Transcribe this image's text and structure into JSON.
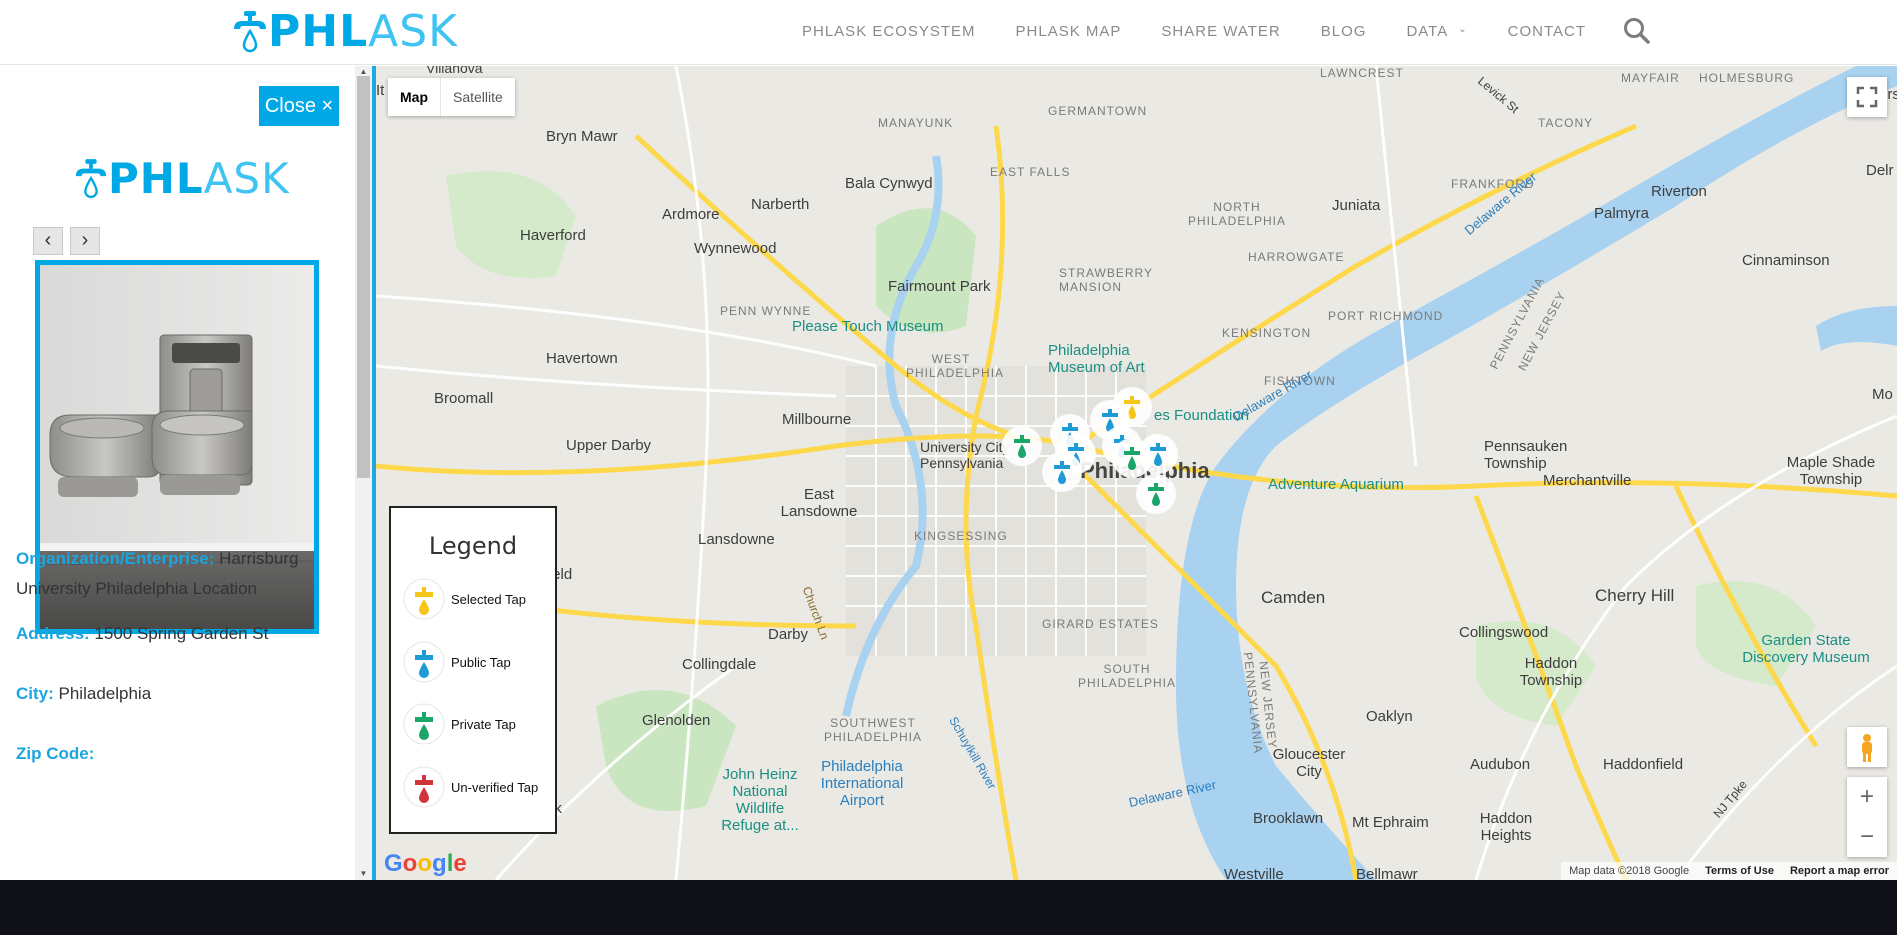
{
  "brand": {
    "logo_part1": "PHL",
    "logo_part2": "ASK",
    "accent": "#00a8e6",
    "accent_light": "#3fc3f3"
  },
  "nav": {
    "items": [
      {
        "label": "PHLASK ECOSYSTEM"
      },
      {
        "label": "PHLASK MAP"
      },
      {
        "label": "SHARE WATER"
      },
      {
        "label": "BLOG"
      },
      {
        "label": "DATA",
        "has_dropdown": true
      },
      {
        "label": "CONTACT"
      }
    ],
    "search_icon": "search-icon"
  },
  "sidepanel": {
    "close_label": "Close ×",
    "prev_label": "‹",
    "next_label": "›",
    "photo_alt_icon": "water-fountain-photo",
    "fields": [
      {
        "key": "Organization/Enterprise:",
        "value": "Harrisburg University Philadelphia Location"
      },
      {
        "key": "Address:",
        "value": "1500 Spring Garden St"
      },
      {
        "key": "City:",
        "value": "Philadelphia"
      },
      {
        "key": "Zip Code:",
        "value": ""
      }
    ]
  },
  "map": {
    "type_buttons": {
      "map": "Map",
      "satellite": "Satellite"
    },
    "legend": {
      "title": "Legend",
      "items": [
        {
          "label": "Selected Tap",
          "color": "#f5c518"
        },
        {
          "label": "Public Tap",
          "color": "#1e9bd7"
        },
        {
          "label": "Private Tap",
          "color": "#1aa56a"
        },
        {
          "label": "Un-verified Tap",
          "color": "#d0343b"
        }
      ]
    },
    "zoom_in": "+",
    "zoom_out": "−",
    "google": "Google",
    "attribution": {
      "data": "Map data ©2018 Google",
      "terms": "Terms of Use",
      "report": "Report a map error"
    },
    "labels": {
      "villanova": "Villanova",
      "bryn_mawr": "Bryn Mawr",
      "manayunk": "MANAYUNK",
      "germantown": "GERMANTOWN",
      "lawncrest": "LAWNCREST",
      "holmesburg": "HOLMESBURG",
      "mayfair": "MAYFAIR",
      "tacony": "TACONY",
      "bala": "Bala Cynwyd",
      "east_falls": "EAST FALLS",
      "ardmore": "Ardmore",
      "narberth": "Narberth",
      "haverford": "Haverford",
      "wynnewood": "Wynnewood",
      "juniata": "Juniata",
      "frankford": "FRANKFORD",
      "riverton": "Riverton",
      "palmyra": "Palmyra",
      "north_philadelphia": "NORTH PHILADELPHIA",
      "harrowgate": "HARROWGATE",
      "strawberry": "STRAWBERRY MANSION",
      "fairmount": "Fairmount Park",
      "penn_wynne": "PENN WYNNE",
      "please_touch": "Please Touch Museum",
      "kensington": "KENSINGTON",
      "port_richmond": "PORT RICHMOND",
      "cinnaminson": "Cinnaminson",
      "havertown": "Havertown",
      "west_philadelphia": "WEST PHILADELPHIA",
      "art_museum": "Philadelphia Museum of Art",
      "fishtown": "FISHTOWN",
      "broomall": "Broomall",
      "millbourne": "Millbourne",
      "foundation": "es Foundation",
      "upper_darby": "Upper Darby",
      "univ": "University City Pennsylvania",
      "philadelphia": "Philadelphia",
      "adventure": "Adventure Aquarium",
      "pennsauken": "Pennsauken Township",
      "merchantville": "Merchantville",
      "maple_shade": "Maple Shade Township",
      "east_lansdowne": "East Lansdowne",
      "lansdowne": "Lansdowne",
      "kingsessing": "KINGSESSING",
      "camden": "Camden",
      "cherry_hill": "Cherry Hill",
      "collingswood": "Collingswood",
      "garden_state": "Garden State Discovery Museum",
      "darby": "Darby",
      "collingdale": "Collingdale",
      "girard": "GIRARD ESTATES",
      "south_philadelphia": "SOUTH PHILADELPHIA",
      "haddon_township": "Haddon Township",
      "glenolden": "Glenolden",
      "southwest": "SOUTHWEST PHILADELPHIA",
      "oaklyn": "Oaklyn",
      "audubon": "Audubon",
      "haddonfield": "Haddonfield",
      "heinz": "John Heinz National Wildlife Refuge at...",
      "airport": "Philadelphia International Airport",
      "gloucester": "Gloucester City",
      "brooklawn": "Brooklawn",
      "mt_ephraim": "Mt Ephraim",
      "haddon_heights": "Haddon Heights",
      "ngfield": "ngfield",
      "park": "Park",
      "westville": "Westville",
      "bellmawr": "Bellmawr",
      "delaware_river": "Delaware River",
      "schuylkill": "Schuylkill River",
      "pennsylvania": "PENNSYLVANIA",
      "new_jersey": "NEW JERSEY",
      "levick": "Levick St",
      "church": "Church Ln",
      "nj_tpke": "NJ Tpke",
      "mo": "Mo",
      "delr": "Delr",
      "ers": "ers",
      "it": "It"
    }
  }
}
